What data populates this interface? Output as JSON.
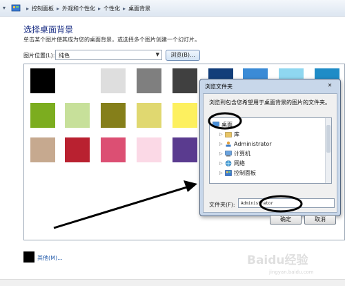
{
  "address_bar": {
    "crumbs": [
      "控制面板",
      "外观和个性化",
      "个性化",
      "桌面背景"
    ]
  },
  "page": {
    "title": "选择桌面背景",
    "description": "单击某个图片使其成为您的桌面背景，或选择多个图片创建一个幻灯片。",
    "location_label": "图片位置(L):",
    "location_value": "纯色",
    "browse_label": "浏览(B)...",
    "other_link": "其他(M)..."
  },
  "swatches": [
    {
      "color": "#000000"
    },
    {
      "color": "#ffffff"
    },
    {
      "color": "#dedede"
    },
    {
      "color": "#7f7f7f"
    },
    {
      "color": "#404040"
    },
    {
      "color": "#123e7a"
    },
    {
      "color": "#3b8bd6"
    },
    {
      "color": "#8fd7f0"
    },
    {
      "color": "#1f8cc7"
    },
    {
      "color": "#7cad1f"
    },
    {
      "color": "#c7e09a"
    },
    {
      "color": "#857f1a"
    },
    {
      "color": "#e0d870"
    },
    {
      "color": "#fdf05f"
    },
    {
      "color": "#c6a98f"
    },
    {
      "color": "#b92130"
    },
    {
      "color": "#dc4f73"
    },
    {
      "color": "#fbd9e6"
    },
    {
      "color": "#5a3b8f"
    }
  ],
  "dialog": {
    "title": "浏览文件夹",
    "close_label": "✕",
    "prompt": "浏览到包含您希望用于桌面背景的图片的文件夹。",
    "tree": [
      {
        "label": "桌面",
        "icon": "desktop-icon",
        "expanded": true
      },
      {
        "label": "库",
        "icon": "library-icon"
      },
      {
        "label": "Administrator",
        "icon": "user-folder-icon"
      },
      {
        "label": "计算机",
        "icon": "computer-icon"
      },
      {
        "label": "网络",
        "icon": "network-icon"
      },
      {
        "label": "控制面板",
        "icon": "control-panel-icon"
      }
    ],
    "folder_label": "文件夹(F):",
    "folder_value": "Administrator",
    "ok_label": "确定",
    "cancel_label": "取消"
  },
  "watermark": {
    "text": "Baidu经验",
    "sub": "jingyan.baidu.com"
  },
  "colors": {
    "annotation": "#000000",
    "title_blue": "#1e3287",
    "link_blue": "#1e57a8"
  }
}
